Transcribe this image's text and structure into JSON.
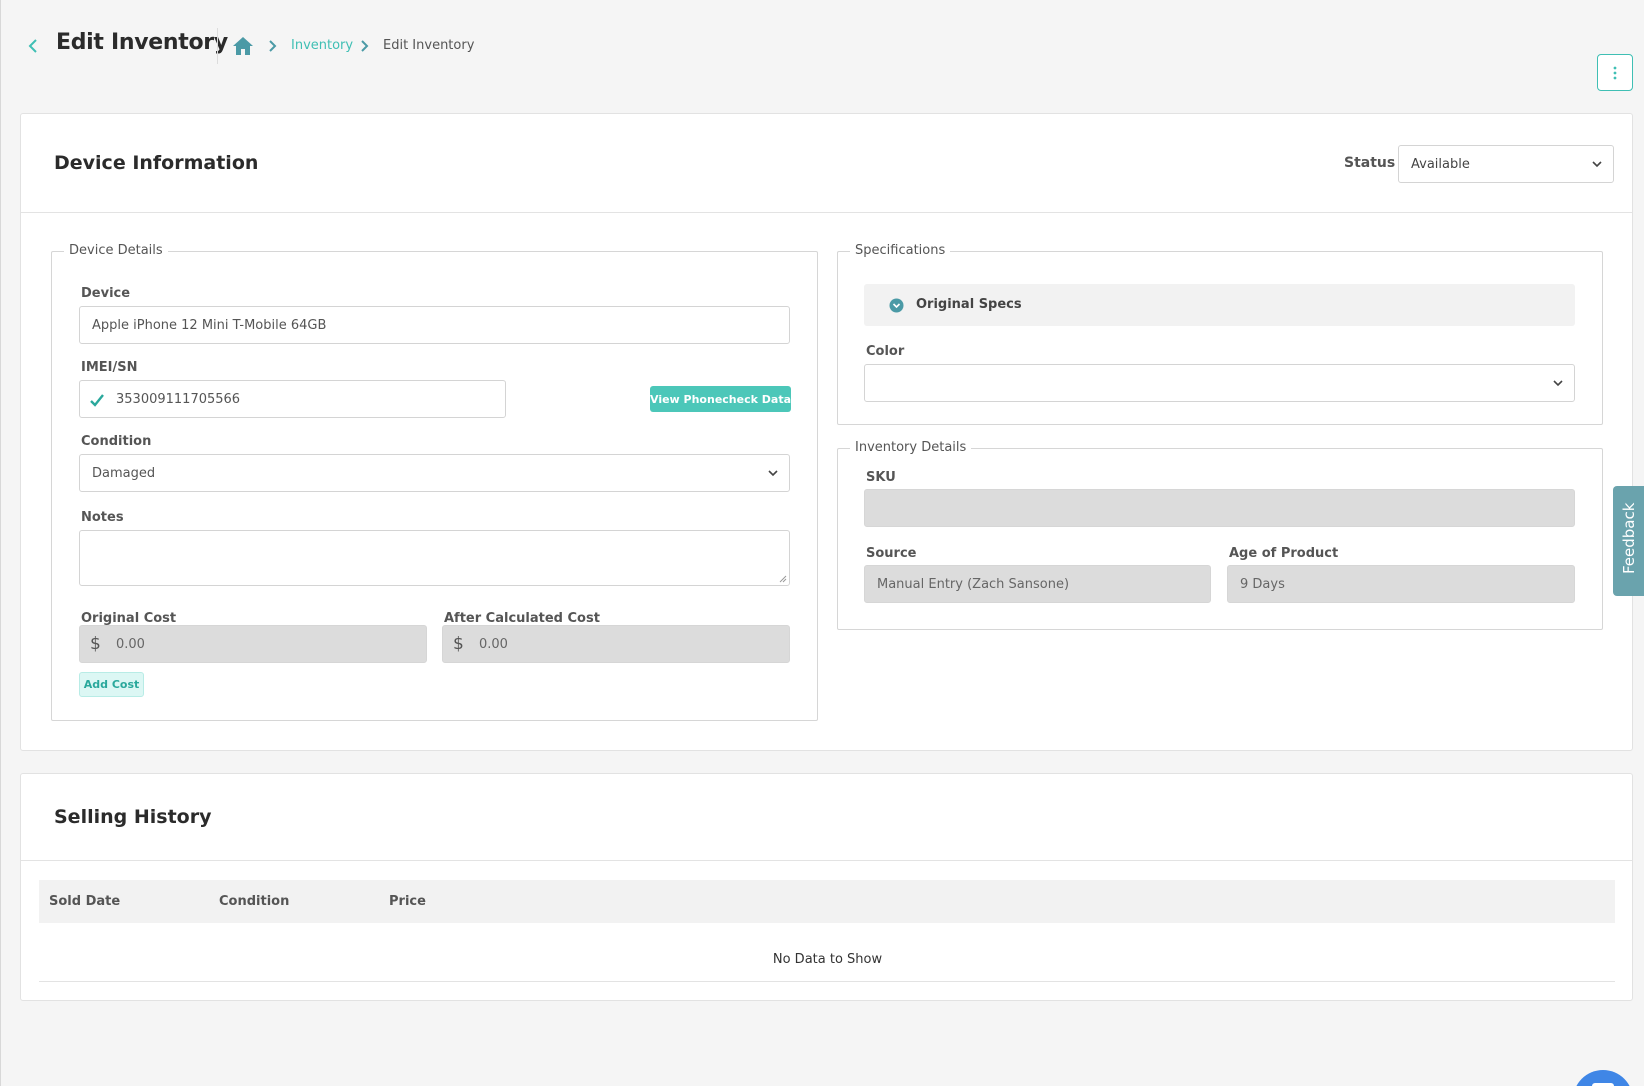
{
  "header": {
    "title": "Edit Inventory",
    "breadcrumb": {
      "link": "Inventory",
      "current": "Edit Inventory"
    }
  },
  "device_information": {
    "title": "Device Information",
    "status": {
      "label": "Status",
      "value": "Available"
    },
    "device_details": {
      "legend": "Device Details",
      "device": {
        "label": "Device",
        "value": "Apple iPhone 12 Mini T-Mobile 64GB"
      },
      "imei": {
        "label": "IMEI/SN",
        "value": "353009111705566",
        "button": "View Phonecheck Data"
      },
      "condition": {
        "label": "Condition",
        "value": "Damaged"
      },
      "notes": {
        "label": "Notes",
        "value": ""
      },
      "original_cost": {
        "label": "Original Cost",
        "currency": "$",
        "value": "0.00"
      },
      "after_calculated_cost": {
        "label": "After Calculated Cost",
        "currency": "$",
        "value": "0.00"
      },
      "add_cost_button": "Add Cost"
    },
    "specifications": {
      "legend": "Specifications",
      "original_specs": "Original Specs",
      "color": {
        "label": "Color",
        "value": ""
      }
    },
    "inventory_details": {
      "legend": "Inventory Details",
      "sku": {
        "label": "SKU",
        "value": ""
      },
      "source": {
        "label": "Source",
        "value": "Manual Entry (Zach Sansone)"
      },
      "age": {
        "label": "Age of Product",
        "value": "9 Days"
      }
    }
  },
  "selling_history": {
    "title": "Selling History",
    "columns": [
      "Sold Date",
      "Condition",
      "Price"
    ],
    "empty_text": "No Data to Show"
  },
  "feedback_label": "Feedback",
  "colors": {
    "accent": "#3fbfb4",
    "button": "#4cc7b9",
    "feedback": "#6aa3ad",
    "chat": "#3f86e6"
  }
}
